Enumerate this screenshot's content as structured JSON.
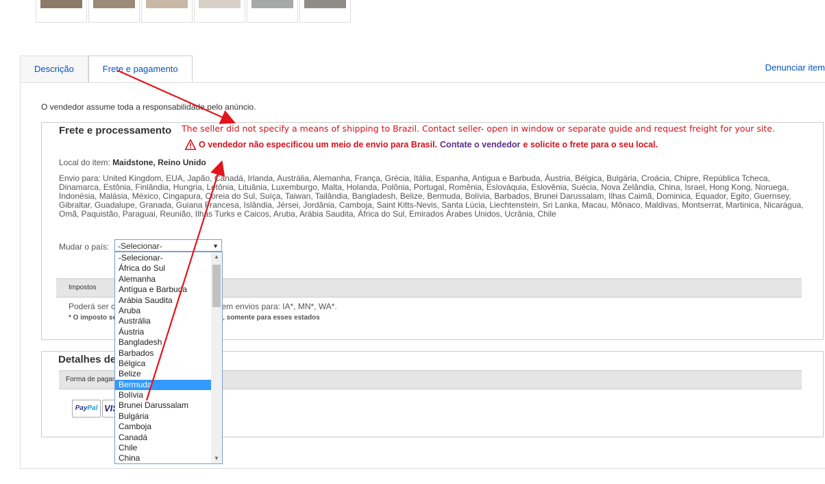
{
  "thumbnails": [
    "thumb-1",
    "thumb-2",
    "thumb-3",
    "thumb-4",
    "thumb-5",
    "thumb-6"
  ],
  "tabs": [
    {
      "label": "Descrição",
      "active": false
    },
    {
      "label": "Frete e pagamento",
      "active": true
    }
  ],
  "report_link": "Denunciar item",
  "responsibility": "O vendedor assume toda a responsabilidade pelo anúncio.",
  "shipping": {
    "heading": "Frete e processamento",
    "local_label": "Local do item:",
    "local_value": "Maidstone, Reino Unido",
    "ships_to": "Envio para: United Kingdom, EUA, Japão, Canadá, Irlanda, Austrália, Alemanha, França, Grécia, Itália, Espanha, Antigua e Barbuda, Áustria, Bélgica, Bulgária, Croácia, Chipre, República Tcheca, Dinamarca, Estônia, Finlândia, Hungria, Letônia, Lituânia, Luxemburgo, Malta, Holanda, Polônia, Portugal, Romênia, Eslováquia, Eslovênia, Suécia, Nova Zelândia, China, Israel, Hong Kong, Noruega, Indonésia, Malásia, México, Cingapura, Coreia do Sul, Suíça, Taiwan, Tailândia, Bangladesh, Belize, Bermuda, Bolívia, Barbados, Brunei Darussalam, Ilhas Caimã, Dominica, Equador, Egito, Guernsey, Gibraltar, Guadalupe, Granada, Guiana Francesa, Islândia, Jérsei, Jordânia, Camboja, Saint Kitts-Nevis, Santa Lúcia, Liechtenstein, Sri Lanka, Macau, Mônaco, Maldivas, Montserrat, Martinica, Nicarágua, Omã, Paquistão, Paraguai, Reunião, Ilhas Turks e Caicos, Aruba, Arábia Saudita, África do Sul, Emirados Árabes Unidos, Ucrânia, Chile",
    "change_country_label": "Mudar o país:",
    "select_value": "-Selecionar-"
  },
  "annotation": {
    "en": "The seller did not specify a means of shipping to Brazil. Contact seller- open in window or separate guide and request freight for your site.",
    "pt_part1": "O vendedor não especificou um meio de envio para Brasil.",
    "pt_contact": "Contate o vendedor",
    "pt_part2": "e solicite o frete para o seu local.",
    "color": "#d4111a"
  },
  "taxes": {
    "bar_label": "Impostos",
    "text": "Poderá ser cobrado imposto sobre venda em envios para: IA*, MN*, WA*.",
    "note": "* O imposto se aplica ao frete e processamento, somente para esses estados"
  },
  "payment": {
    "heading": "Detalhes de pagamento",
    "bar_label": "Forma de pagamento",
    "methods": [
      "PayPal",
      "VISA"
    ]
  },
  "dropdown": {
    "selected": "Bermuda",
    "options": [
      "-Selecionar-",
      "África do Sul",
      "Alemanha",
      "Antígua e Barbuda",
      "Arábia Saudita",
      "Aruba",
      "Austrália",
      "Áustria",
      "Bangladesh",
      "Barbados",
      "Bélgica",
      "Belize",
      "Bermuda",
      "Bolívia",
      "Brunei Darussalam",
      "Bulgária",
      "Camboja",
      "Canadá",
      "Chile",
      "China"
    ]
  }
}
